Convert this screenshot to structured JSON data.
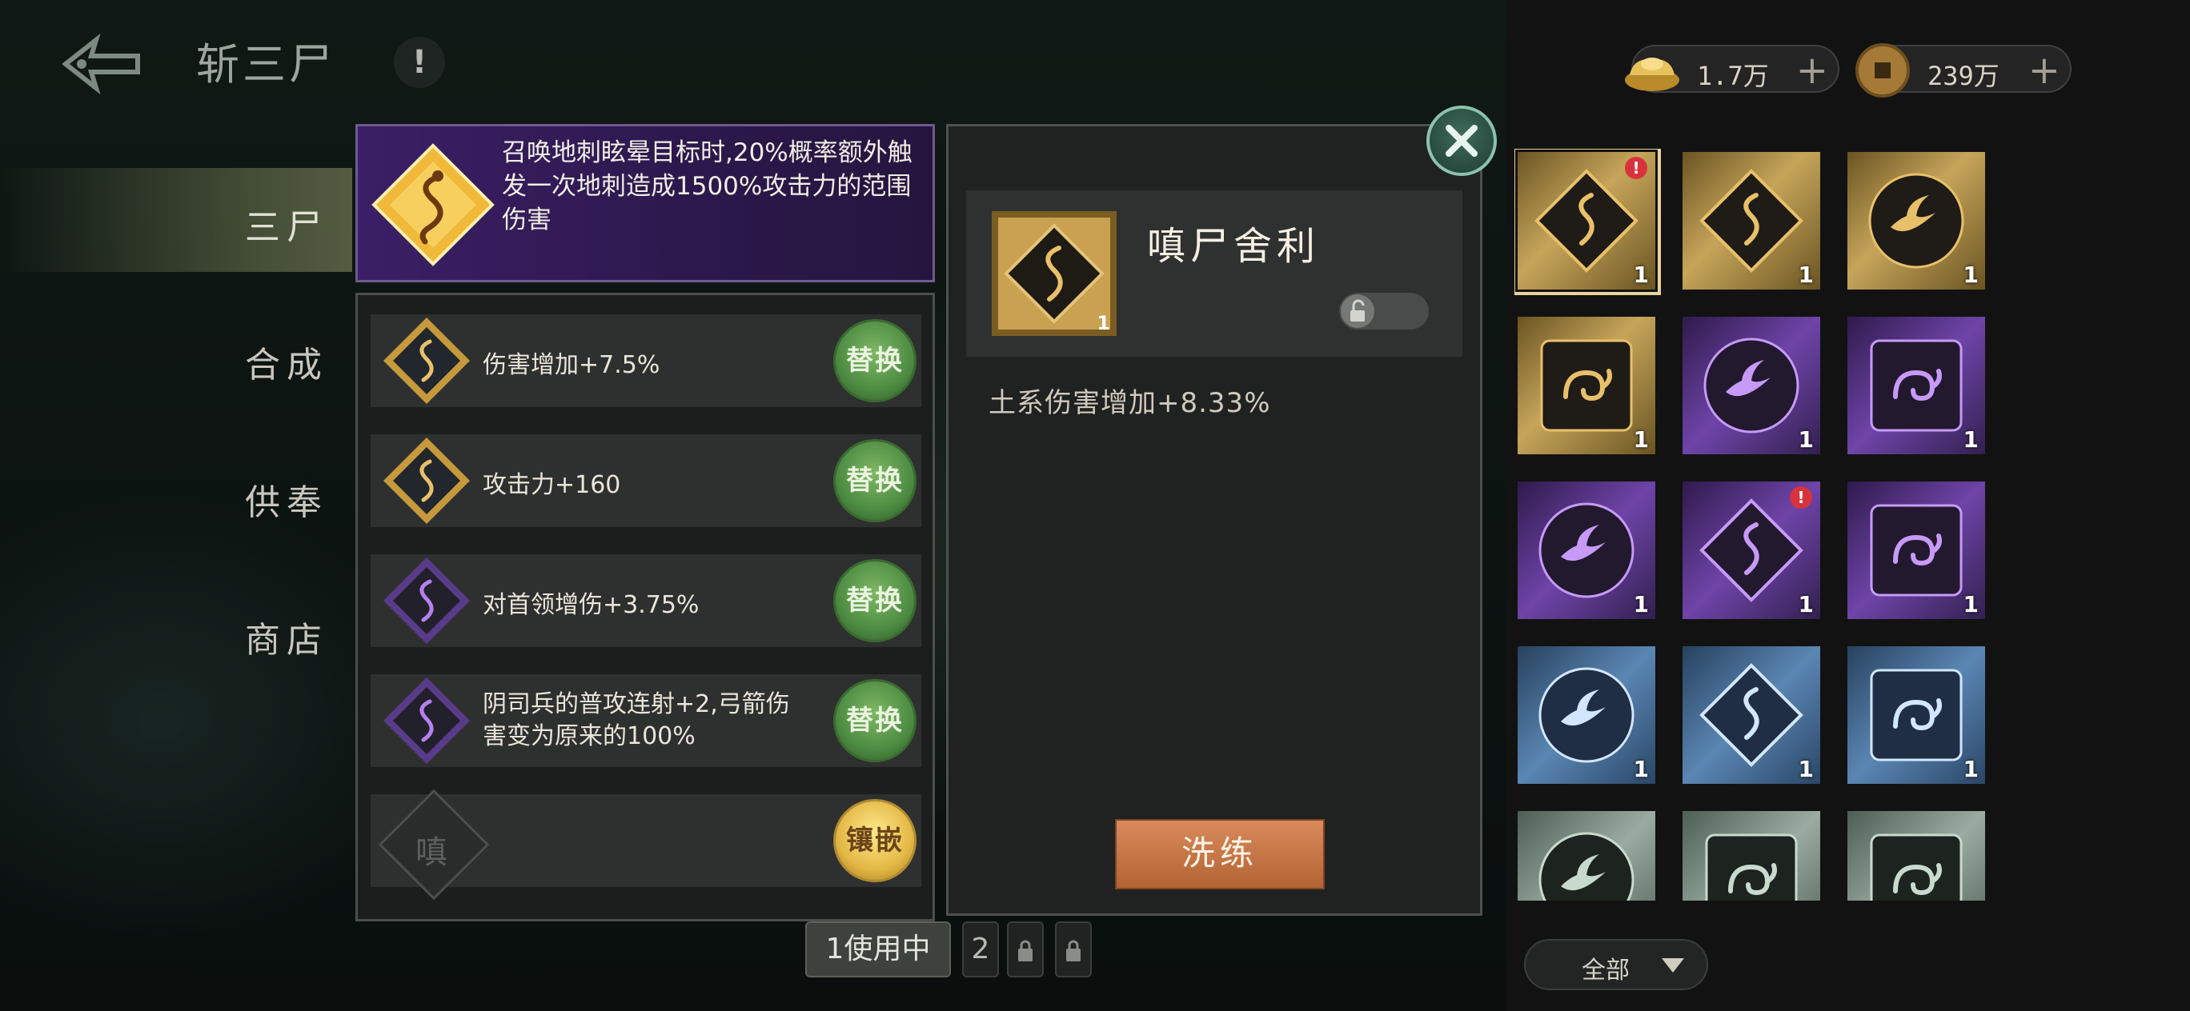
{
  "header": {
    "title": "斩三尸",
    "info_label": "!",
    "currencies": [
      {
        "icon": "gold-ingot-icon",
        "amount": "1.7万",
        "plus": "+"
      },
      {
        "icon": "copper-coin-icon",
        "amount": "239万",
        "plus": "+"
      }
    ]
  },
  "nav": {
    "items": [
      {
        "label": "三尸",
        "active": true
      },
      {
        "label": "合成",
        "active": false
      },
      {
        "label": "供奉",
        "active": false
      },
      {
        "label": "商店",
        "active": false
      }
    ]
  },
  "skill": {
    "icon": "golden-serpent-rune-icon",
    "description": "召唤地刺眩晕目标时,20%概率额外触发一次地刺造成1500%攻击力的范围伤害"
  },
  "attributes": [
    {
      "icon": "gold-serpent-gem-icon",
      "text": "伤害增加+7.5%",
      "button": "替换"
    },
    {
      "icon": "gold-serpent-gem-icon",
      "text": "攻击力+160",
      "button": "替换"
    },
    {
      "icon": "purple-serpent-gem-icon",
      "text": "对首领增伤+3.75%",
      "button": "替换"
    },
    {
      "icon": "purple-serpent-gem-icon",
      "text": "阴司兵的普攻连射+2,弓箭伤害变为原来的100%",
      "button": "替换"
    }
  ],
  "empty_slot": {
    "label": "嗔",
    "button": "镶嵌"
  },
  "pager": {
    "tabs": [
      {
        "label": "1使用中",
        "active": true
      },
      {
        "label": "2",
        "active": false
      },
      {
        "label": "locked",
        "icon": "lock-icon"
      },
      {
        "label": "locked",
        "icon": "lock-icon"
      }
    ]
  },
  "detail": {
    "name": "嗔尸舍利",
    "count": "1",
    "stat": "土系伤害增加+8.33%",
    "refine_button": "洗练",
    "lock_icon": "unlock-icon"
  },
  "inventory": {
    "items": [
      {
        "rarity": "gold",
        "icon": "serpent-rune-icon",
        "count": "1",
        "selected": true,
        "alert": true
      },
      {
        "rarity": "gold",
        "icon": "serpent-rune-icon",
        "count": "1",
        "selected": false,
        "alert": false
      },
      {
        "rarity": "gold",
        "icon": "bird-orb-icon",
        "count": "1",
        "selected": false,
        "alert": false
      },
      {
        "rarity": "gold",
        "icon": "spiral-tile-icon",
        "count": "1",
        "selected": false,
        "alert": false
      },
      {
        "rarity": "purple",
        "icon": "bird-orb-icon",
        "count": "1",
        "selected": false,
        "alert": false
      },
      {
        "rarity": "purple",
        "icon": "spiral-tile-icon",
        "count": "1",
        "selected": false,
        "alert": false
      },
      {
        "rarity": "purple",
        "icon": "bird-orb-icon",
        "count": "1",
        "selected": false,
        "alert": false
      },
      {
        "rarity": "purple",
        "icon": "serpent-rune-icon",
        "count": "1",
        "selected": false,
        "alert": true
      },
      {
        "rarity": "purple",
        "icon": "spiral-tile-icon",
        "count": "1",
        "selected": false,
        "alert": false
      },
      {
        "rarity": "blue",
        "icon": "bird-orb-icon",
        "count": "1",
        "selected": false,
        "alert": false
      },
      {
        "rarity": "blue",
        "icon": "serpent-rune-icon",
        "count": "1",
        "selected": false,
        "alert": false
      },
      {
        "rarity": "blue",
        "icon": "spiral-tile-icon",
        "count": "1",
        "selected": false,
        "alert": false
      },
      {
        "rarity": "green",
        "icon": "bird-orb-icon",
        "count": "",
        "selected": false,
        "alert": false
      },
      {
        "rarity": "green",
        "icon": "spiral-tile-icon",
        "count": "",
        "selected": false,
        "alert": false
      },
      {
        "rarity": "green",
        "icon": "spiral-tile-icon",
        "count": "",
        "selected": false,
        "alert": false
      }
    ],
    "filter_label": "全部",
    "alert_mark": "!"
  },
  "colors": {
    "gold": "#c6a55a",
    "purple": "#6e44a8",
    "blue": "#5a86b3",
    "green": "#9aaca1",
    "swap_button": "#4d8c42",
    "embed_button": "#e3b845",
    "refine_button": "#c0703f"
  }
}
